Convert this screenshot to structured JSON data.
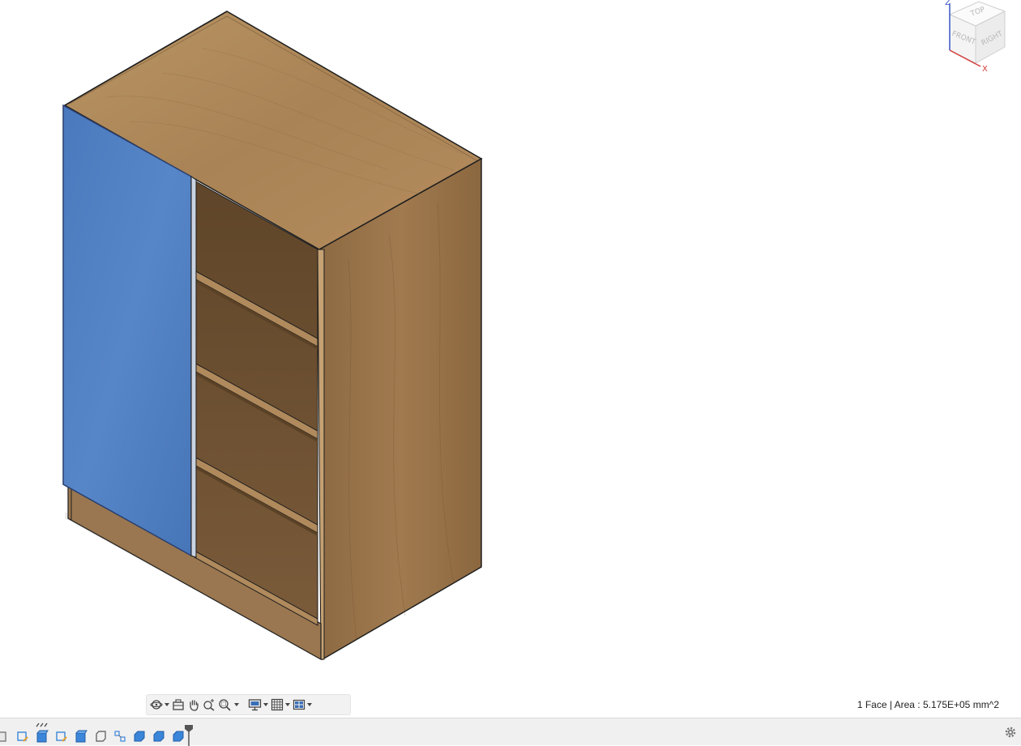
{
  "status": {
    "selection_info": "1 Face | Area : 5.175E+05 mm^2"
  },
  "viewcube": {
    "top_label": "TOP",
    "front_label": "FRONT",
    "right_label": "RIGHT",
    "axis_z": "Z",
    "axis_x": "X",
    "axis_z_color": "#3a55c8",
    "axis_x_color": "#d63b3b"
  },
  "colors": {
    "wood_top": "#b48c5e",
    "wood_side": "#977148",
    "wood_inner": "#6e5233",
    "door_blue": "#4f7fc3",
    "edge": "#1e1e1e",
    "toolbar_bg": "#f2f2f2",
    "timeline_blue": "#3b86d8"
  },
  "nav_toolbar": {
    "items": [
      {
        "icon": "orbit-icon",
        "has_menu": true
      },
      {
        "icon": "look-at-icon",
        "has_menu": false
      },
      {
        "icon": "pan-hand-icon",
        "has_menu": false
      },
      {
        "icon": "zoom-icon",
        "has_menu": false
      },
      {
        "icon": "zoom-window-icon",
        "has_menu": true
      },
      {
        "icon": "display-settings-icon",
        "has_menu": true
      },
      {
        "icon": "grid-icon",
        "has_menu": true
      },
      {
        "icon": "viewports-icon",
        "has_menu": true
      }
    ]
  },
  "timeline": {
    "items": [
      "sketch-icon",
      "sketch-icon",
      "extrude-icon",
      "sketch-icon",
      "extrude-icon",
      "body-icon",
      "move-icon",
      "component-icon",
      "component-icon",
      "component-icon"
    ]
  }
}
